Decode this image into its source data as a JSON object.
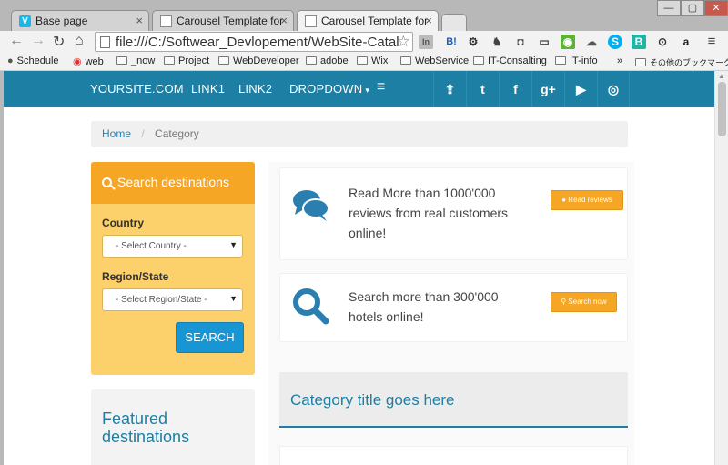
{
  "browser": {
    "tabs": [
      {
        "title": "Base page",
        "active": false
      },
      {
        "title": "Carousel Template for B",
        "active": false
      },
      {
        "title": "Carousel Template for B",
        "active": true
      }
    ],
    "window_controls": {
      "minimize": "—",
      "maximize": "▢",
      "close": "✕"
    },
    "address": "file:///C:/Softwear_Devlopement/WebSite-Catal",
    "extensions": [
      "In",
      "B!",
      "⚙",
      "♞",
      "◘",
      "▭",
      "◉",
      "☁",
      "S",
      "B",
      "⊙",
      "a",
      "≡"
    ],
    "bookmarks": [
      "Schedule",
      "web",
      "_now",
      "Project",
      "WebDeveloper",
      "adobe",
      "Wix",
      "WebService",
      "IT-Consalting",
      "IT-info"
    ],
    "bookmarks_overflow": "»",
    "other_bookmarks": "その他のブックマーク"
  },
  "site": {
    "brand": "YOURSITE.COM",
    "nav": {
      "link1": "LINK1",
      "link2": "LINK2",
      "dropdown": "DROPDOWN",
      "caret": "▾",
      "menu": "≡"
    },
    "social": [
      "⇪",
      "t",
      "f",
      "g+",
      "▶",
      "◎"
    ],
    "breadcrumb": {
      "home": "Home",
      "sep": "/",
      "current": "Category"
    },
    "search": {
      "title": "Search destinations",
      "country_label": "Country",
      "country_value": "- Select Country -",
      "region_label": "Region/State",
      "region_value": "- Select Region/State -",
      "button": "SEARCH"
    },
    "featured_title": "Featured destinations",
    "cards": [
      {
        "text": "Read More than 1000'000 reviews from real customers online!",
        "button": "Read reviews"
      },
      {
        "text": "Search more than 300'000 hotels online!",
        "button": "Search now"
      }
    ],
    "category_title": "Category title goes here"
  },
  "colors": {
    "nav": "#1d7fa3",
    "accent": "#f5a624",
    "search_bg": "#fcd06b",
    "primary": "#1895d3"
  }
}
